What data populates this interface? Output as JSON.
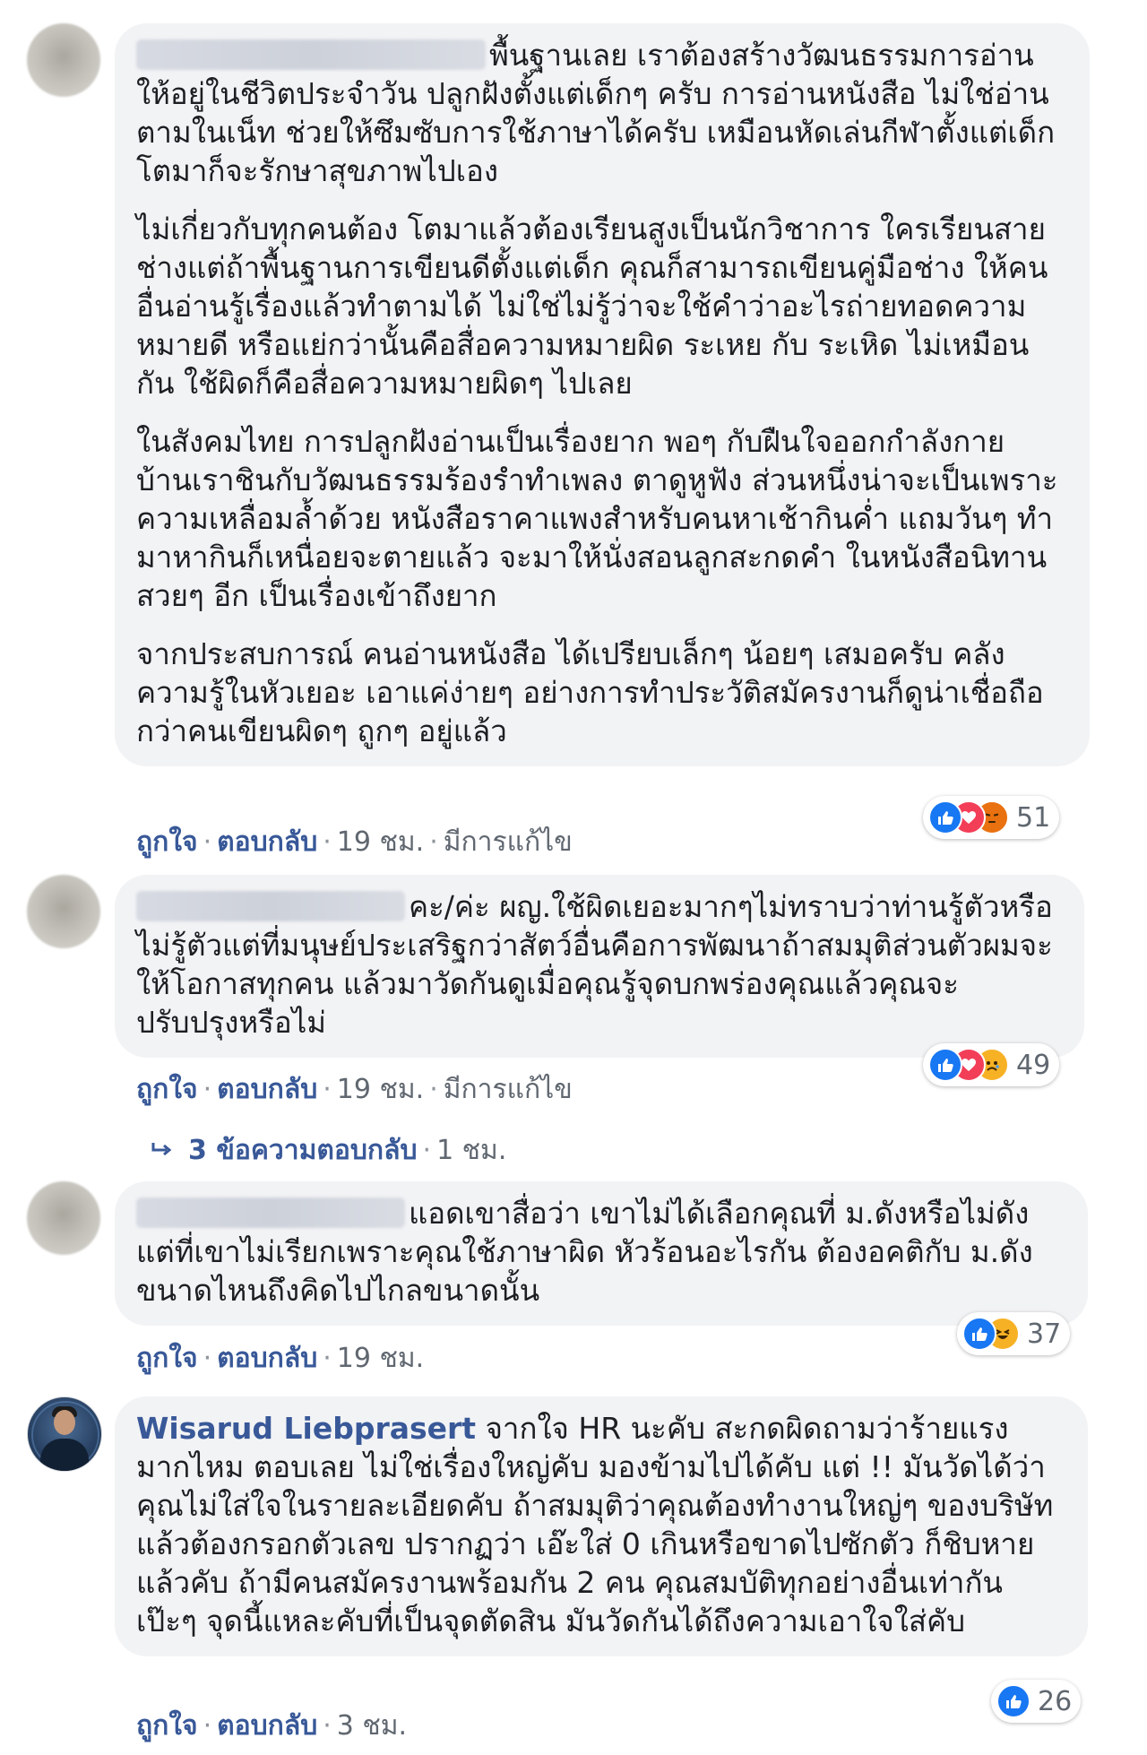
{
  "comments": [
    {
      "author": "",
      "paragraphs": [
        "พื้นฐานเลย เราต้องสร้างวัฒนธรรมการอ่านให้อยู่ในชีวิตประจำวัน ปลูกฝังตั้งแต่เด็กๆ ครับ การอ่านหนังสือ ไม่ใช่อ่านตามในเน็ท ช่วยให้ซึมซับการใช้ภาษาได้ครับ เหมือนหัดเล่นกีฬาตั้งแต่เด็ก โตมาก็จะรักษาสุขภาพไปเอง",
        "ไม่เกี่ยวกับทุกคนต้อง โตมาแล้วต้องเรียนสูงเป็นนักวิชาการ ใครเรียนสายช่างแต่ถ้าพื้นฐานการเขียนดีตั้งแต่เด็ก คุณก็สามารถเขียนคู่มือช่าง ให้คนอื่นอ่านรู้เรื่องแล้วทำตามได้ ไม่ใช่ไม่รู้ว่าจะใช้คำว่าอะไรถ่ายทอดความหมายดี หรือแย่กว่านั้นคือสื่อความหมายผิด ระเหย กับ ระเหิด ไม่เหมือนกัน ใช้ผิดก็คือสื่อความหมายผิดๆ ไปเลย",
        "ในสังคมไทย การปลูกฝังอ่านเป็นเรื่องยาก พอๆ กับฝืนใจออกกำลังกาย บ้านเราชินกับวัฒนธรรมร้องรำทำเพลง ตาดูหูฟัง ส่วนหนึ่งน่าจะเป็นเพราะความเหลื่อมล้ำด้วย หนังสือราคาแพงสำหรับคนหาเช้ากินค่ำ แถมวันๆ ทำมาหากินก็เหนื่อยจะตายแล้ว จะมาให้นั่งสอนลูกสะกดคำ ในหนังสือนิทานสวยๆ อีก เป็นเรื่องเข้าถึงยาก",
        "จากประสบการณ์ คนอ่านหนังสือ ได้เปรียบเล็กๆ น้อยๆ เสมอครับ คลังความรู้ในหัวเยอะ เอาแค่ง่ายๆ อย่างการทำประวัติสมัครงานก็ดูน่าเชื่อถือกว่าคนเขียนผิดๆ ถูกๆ อยู่แล้ว"
      ],
      "reactions": [
        "like",
        "love",
        "angry"
      ],
      "reaction_count": "51",
      "like_label": "ถูกใจ",
      "reply_label": "ตอบกลับ",
      "time": "19 ชม.",
      "edited": "มีการแก้ไข"
    },
    {
      "author": "",
      "paragraphs": [
        "คะ/ค่ะ ผญ.ใช้ผิดเยอะมากๆไม่ทราบว่าท่านรู้ตัวหรือไม่รู้ตัวแต่ที่มนุษย์ประเสริฐกว่าสัตว์อื่นคือการพัฒนาถ้าสมมุติส่วนตัวผมจะให้โอกาสทุกคน แล้วมาวัดกันดูเมื่อคุณรู้จุดบกพร่องคุณแล้วคุณจะปรับปรุงหรือไม่"
      ],
      "reactions": [
        "like",
        "love",
        "sad"
      ],
      "reaction_count": "49",
      "like_label": "ถูกใจ",
      "reply_label": "ตอบกลับ",
      "time": "19 ชม.",
      "edited": "มีการแก้ไข",
      "replies_label": "3 ข้อความตอบกลับ",
      "replies_time": "1 ชม."
    },
    {
      "author": "",
      "paragraphs": [
        "แอดเขาสื่อว่า เขาไม่ได้เลือกคุณที่ ม.ดังหรือไม่ดัง แต่ที่เขาไม่เรียกเพราะคุณใช้ภาษาผิด หัวร้อนอะไรกัน ต้องอคติกับ ม.ดัง ขนาดไหนถึงคิดไปไกลขนาดนั้น"
      ],
      "reactions": [
        "like",
        "haha"
      ],
      "reaction_count": "37",
      "like_label": "ถูกใจ",
      "reply_label": "ตอบกลับ",
      "time": "19 ชม."
    },
    {
      "author": "Wisarud Liebprasert",
      "paragraphs": [
        "จากใจ HR นะคับ สะกดผิดถามว่าร้ายแรงมากไหม ตอบเลย ไม่ใช่เรื่องใหญ่คับ มองข้ามไปได้คับ แต่ !! มันวัดได้ว่าคุณไม่ใส่ใจในรายละเอียดคับ ถ้าสมมุติว่าคุณต้องทำงานใหญ่ๆ ของบริษัทแล้วต้องกรอกตัวเลข ปรากฏว่า เอ๊ะใส่ 0 เกินหรือขาดไปซักตัว ก็ชิบหายแล้วคับ ถ้ามีคนสมัครงานพร้อมกัน 2 คน คุณสมบัติทุกอย่างอื่นเท่ากันเป๊ะๆ จุดนี้แหละคับที่เป็นจุดตัดสิน มันวัดกันได้ถึงความเอาใจใส่คับ"
      ],
      "reactions": [
        "like"
      ],
      "reaction_count": "26",
      "like_label": "ถูกใจ",
      "reply_label": "ตอบกลับ",
      "time": "3 ชม."
    }
  ],
  "colors": {
    "bubble_bg": "#f2f3f5",
    "link": "#385898",
    "meta": "#606770",
    "like": "#1877f2",
    "love": "#f33e58",
    "emoji": "#f7b125"
  }
}
